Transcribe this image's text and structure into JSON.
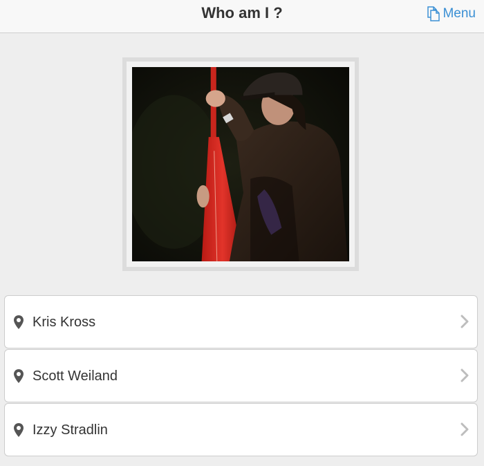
{
  "header": {
    "title": "Who am I ?",
    "menu_label": "Menu",
    "menu_icon": "document-copy-icon"
  },
  "photo": {
    "subject": "guitarist-on-stage"
  },
  "options": [
    {
      "label": "Kris Kross",
      "icon": "map-pin-icon"
    },
    {
      "label": "Scott Weiland",
      "icon": "map-pin-icon"
    },
    {
      "label": "Izzy Stradlin",
      "icon": "map-pin-icon"
    }
  ],
  "colors": {
    "accent": "#3a8fd4",
    "background": "#eeeeee",
    "header_bg": "#f8f8f8"
  }
}
